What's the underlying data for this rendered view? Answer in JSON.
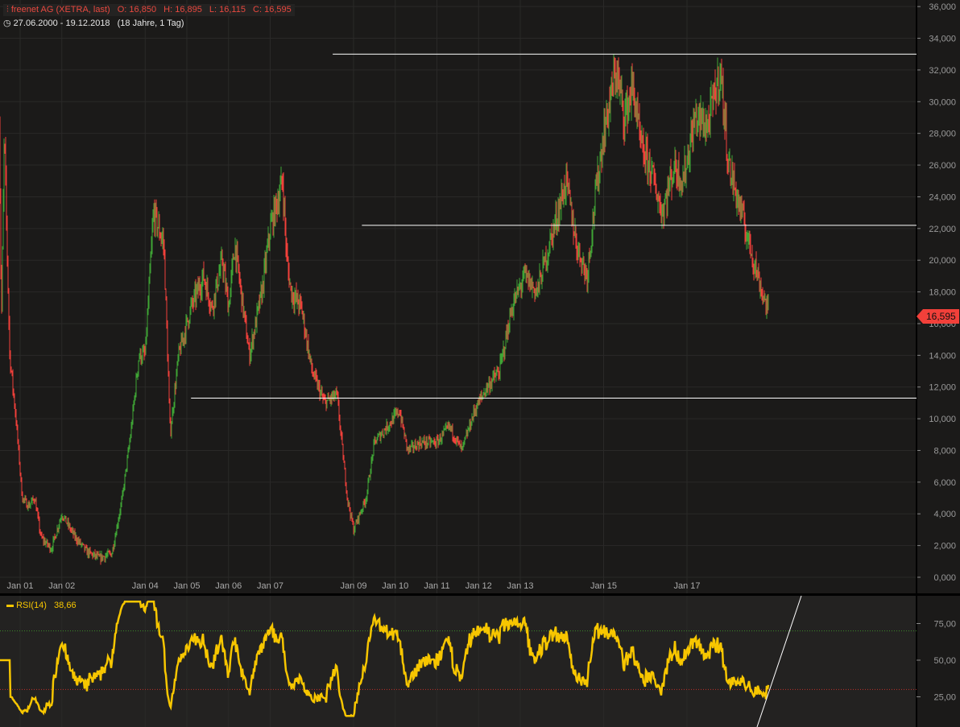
{
  "header": {
    "icon": "candlestick-icon",
    "name": "freenet AG (XETRA, last)",
    "open": "O: 16,850",
    "high": "H: 16,895",
    "low": "L: 16,115",
    "close": "C: 16,595",
    "range_icon": "clock-icon",
    "range": "27.06.2000 - 19.12.2018",
    "duration": "(18 Jahre, 1 Tag)"
  },
  "last_price": "16,595",
  "colors": {
    "up": "#3fa535",
    "down": "#f2403a",
    "rsi": "#f7c600",
    "bg": "#1b1a19",
    "rsi_bg": "#232221"
  },
  "chart_data": [
    {
      "type": "candlestick",
      "title": "freenet AG (XETRA, last)",
      "x_ticks": [
        {
          "label": "Jan 01",
          "t": 2001
        },
        {
          "label": "Jan 02",
          "t": 2002
        },
        {
          "label": "Jan 04",
          "t": 2004
        },
        {
          "label": "Jan 05",
          "t": 2005
        },
        {
          "label": "Jan 06",
          "t": 2006
        },
        {
          "label": "Jan 07",
          "t": 2007
        },
        {
          "label": "Jan 09",
          "t": 2009
        },
        {
          "label": "Jan 10",
          "t": 2010
        },
        {
          "label": "Jan 11",
          "t": 2011
        },
        {
          "label": "Jan 12",
          "t": 2012
        },
        {
          "label": "Jan 13",
          "t": 2013
        },
        {
          "label": "Jan 15",
          "t": 2015
        },
        {
          "label": "Jan 17",
          "t": 2017
        }
      ],
      "y_ticks": [
        "0,000",
        "2,000",
        "4,000",
        "6,000",
        "8,000",
        "10,000",
        "12,000",
        "14,000",
        "16,000",
        "18,000",
        "20,000",
        "22,000",
        "24,000",
        "26,000",
        "28,000",
        "30,000",
        "32,000",
        "34,000",
        "36,000"
      ],
      "ylim": [
        0,
        36
      ],
      "price_path": [
        [
          2000.48,
          34
        ],
        [
          2000.55,
          16
        ],
        [
          2000.62,
          28
        ],
        [
          2000.75,
          14
        ],
        [
          2000.9,
          10
        ],
        [
          2001.05,
          5
        ],
        [
          2001.2,
          4.5
        ],
        [
          2001.35,
          5
        ],
        [
          2001.5,
          2.5
        ],
        [
          2001.75,
          1.8
        ],
        [
          2002.0,
          4
        ],
        [
          2002.3,
          2.6
        ],
        [
          2002.6,
          1.6
        ],
        [
          2002.9,
          1.2
        ],
        [
          2003.2,
          1.5
        ],
        [
          2003.45,
          5
        ],
        [
          2003.65,
          9
        ],
        [
          2003.85,
          14
        ],
        [
          2004.0,
          14
        ],
        [
          2004.2,
          23
        ],
        [
          2004.45,
          21
        ],
        [
          2004.6,
          9
        ],
        [
          2004.8,
          14
        ],
        [
          2005.1,
          17
        ],
        [
          2005.4,
          19
        ],
        [
          2005.6,
          17
        ],
        [
          2005.85,
          20
        ],
        [
          2006.0,
          17
        ],
        [
          2006.15,
          21
        ],
        [
          2006.5,
          14
        ],
        [
          2006.8,
          18
        ],
        [
          2007.0,
          22
        ],
        [
          2007.3,
          25
        ],
        [
          2007.4,
          20
        ],
        [
          2007.5,
          18
        ],
        [
          2007.75,
          17
        ],
        [
          2008.0,
          13
        ],
        [
          2008.3,
          11
        ],
        [
          2008.6,
          11.5
        ],
        [
          2008.85,
          5
        ],
        [
          2009.0,
          3
        ],
        [
          2009.3,
          5
        ],
        [
          2009.5,
          8.5
        ],
        [
          2009.8,
          9.5
        ],
        [
          2010.1,
          10.5
        ],
        [
          2010.3,
          8
        ],
        [
          2010.6,
          8.5
        ],
        [
          2011.0,
          8.5
        ],
        [
          2011.3,
          9.5
        ],
        [
          2011.6,
          8
        ],
        [
          2011.9,
          10.5
        ],
        [
          2012.2,
          12
        ],
        [
          2012.5,
          13
        ],
        [
          2012.8,
          17
        ],
        [
          2013.1,
          19
        ],
        [
          2013.4,
          18
        ],
        [
          2013.8,
          22
        ],
        [
          2014.1,
          25
        ],
        [
          2014.35,
          21
        ],
        [
          2014.6,
          19
        ],
        [
          2014.8,
          24
        ],
        [
          2015.0,
          28
        ],
        [
          2015.3,
          32
        ],
        [
          2015.5,
          29
        ],
        [
          2015.7,
          31
        ],
        [
          2015.9,
          27
        ],
        [
          2016.1,
          26
        ],
        [
          2016.4,
          23
        ],
        [
          2016.7,
          26
        ],
        [
          2016.9,
          25
        ],
        [
          2017.2,
          29
        ],
        [
          2017.5,
          28.5
        ],
        [
          2017.8,
          32
        ],
        [
          2018.0,
          26
        ],
        [
          2018.2,
          24
        ],
        [
          2018.4,
          22
        ],
        [
          2018.6,
          20
        ],
        [
          2018.8,
          18
        ],
        [
          2018.97,
          16.6
        ]
      ],
      "horizontal_lines": [
        {
          "value": 33.0,
          "from": 2008.5
        },
        {
          "value": 22.2,
          "from": 2009.2
        },
        {
          "value": 11.3,
          "from": 2005.1
        }
      ]
    },
    {
      "type": "line",
      "title": "RSI(14)",
      "legend": "RSI(14)",
      "value": "38,66",
      "y_ticks": [
        "25,00",
        "50,00",
        "75,00"
      ],
      "levels": [
        30,
        70
      ],
      "ylim": [
        10,
        95
      ]
    }
  ]
}
